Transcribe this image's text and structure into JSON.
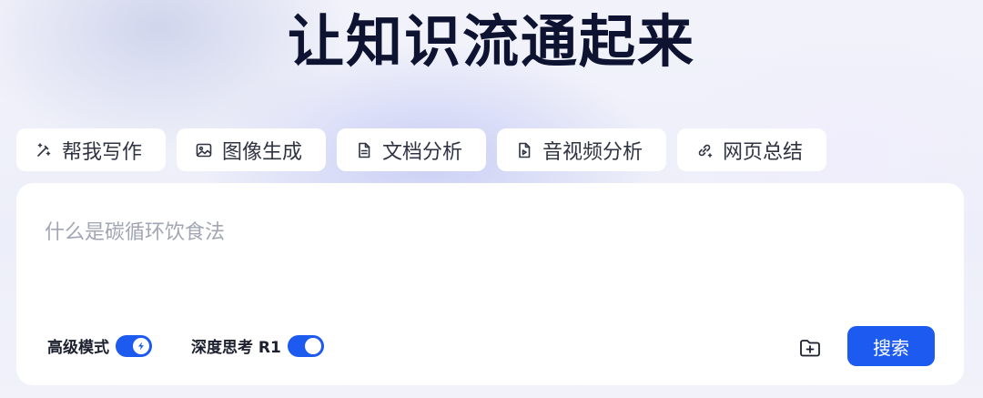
{
  "headline": "让知识流通起来",
  "tools": [
    {
      "label": "帮我写作",
      "icon": "magic-pen-icon"
    },
    {
      "label": "图像生成",
      "icon": "image-icon"
    },
    {
      "label": "文档分析",
      "icon": "document-icon"
    },
    {
      "label": "音视频分析",
      "icon": "media-file-icon"
    },
    {
      "label": "网页总结",
      "icon": "link-icon"
    }
  ],
  "search": {
    "placeholder": "什么是碳循环饮食法",
    "value": ""
  },
  "options": {
    "advanced_mode": {
      "label": "高级模式",
      "enabled": true,
      "icon": "bolt-icon"
    },
    "deep_thinking": {
      "label": "深度思考 R1",
      "enabled": true
    }
  },
  "actions": {
    "upload_icon": "folder-plus-icon",
    "search_label": "搜索"
  },
  "colors": {
    "accent": "#1d5af0",
    "headline": "#0d1330",
    "chip_background": "#ffffff"
  }
}
